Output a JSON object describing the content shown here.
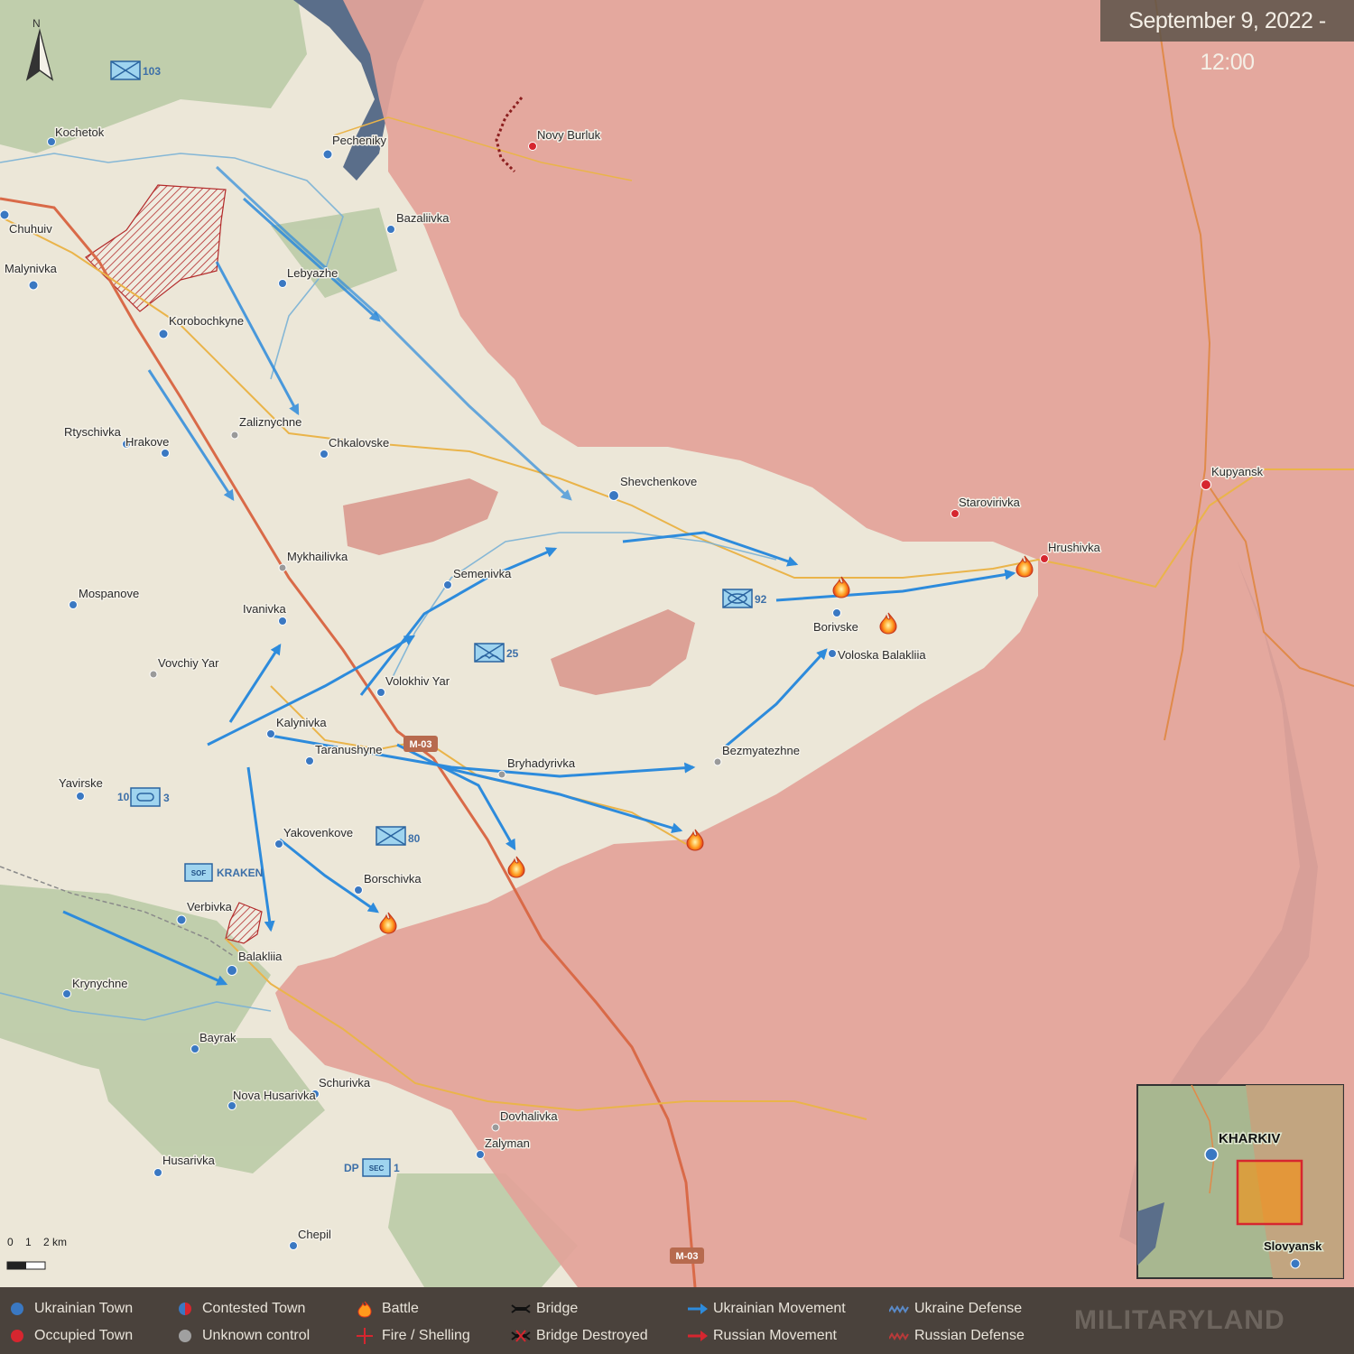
{
  "timestamp": "September 9, 2022 - 12:00",
  "north_label": "N",
  "colors": {
    "occupied": "#e3a399",
    "ukraine_controlled": "#ece7d8",
    "water": "#5a6e8a",
    "ukrainian_town": "#3a78c2",
    "occupied_town": "#d6262f",
    "ukrainian_movement": "#2d8bdc",
    "road_main": "#e07050",
    "road_secondary": "#f0c040"
  },
  "towns": {
    "ukrainian": [
      {
        "name": "Kochetok"
      },
      {
        "name": "Pecheniky"
      },
      {
        "name": "Chuhuiv"
      },
      {
        "name": "Bazaliivka"
      },
      {
        "name": "Malynivka"
      },
      {
        "name": "Lebyazhe"
      },
      {
        "name": "Korobochkyne"
      },
      {
        "name": "Rtyschivka"
      },
      {
        "name": "Hrakove"
      },
      {
        "name": "Chkalovske"
      },
      {
        "name": "Shevchenkove"
      },
      {
        "name": "Semenivka"
      },
      {
        "name": "Mospanove"
      },
      {
        "name": "Ivanivka"
      },
      {
        "name": "Volokhiv Yar"
      },
      {
        "name": "Borivske"
      },
      {
        "name": "Voloska Balakliia"
      },
      {
        "name": "Kalynivka"
      },
      {
        "name": "Taranushyne"
      },
      {
        "name": "Yavirske"
      },
      {
        "name": "Yakovenkove"
      },
      {
        "name": "Borschivka"
      },
      {
        "name": "Verbivka"
      },
      {
        "name": "Balakliia"
      },
      {
        "name": "Krynychne"
      },
      {
        "name": "Bayrak"
      },
      {
        "name": "Schurivka"
      },
      {
        "name": "Nova Husarivka"
      },
      {
        "name": "Zalyman"
      },
      {
        "name": "Husarivka"
      },
      {
        "name": "Chepil"
      }
    ],
    "occupied": [
      {
        "name": "Novy Burluk"
      },
      {
        "name": "Starovirivka"
      },
      {
        "name": "Hrushivka"
      },
      {
        "name": "Kupyansk"
      }
    ],
    "unknown": [
      {
        "name": "Zaliznychne"
      },
      {
        "name": "Mykhailivka"
      },
      {
        "name": "Vovchiy Yar"
      },
      {
        "name": "Bryhadyrivka"
      },
      {
        "name": "Bezmyatezhne"
      },
      {
        "name": "Dovhalivka"
      }
    ]
  },
  "units": [
    {
      "id": "103",
      "type": "infantry"
    },
    {
      "id": "92",
      "type": "mechanized"
    },
    {
      "id": "25",
      "type": "airborne"
    },
    {
      "id": "80",
      "type": "air-assault"
    },
    {
      "id": "10",
      "type": "armor",
      "suffix": "3"
    },
    {
      "id": "SOF",
      "name": "KRAKEN"
    },
    {
      "id": "SEC",
      "prefix": "DP",
      "suffix": "1"
    }
  ],
  "roads": [
    "M-03",
    "M-03"
  ],
  "scale_bar": {
    "labels": [
      "0",
      "1",
      "2 km"
    ]
  },
  "inset": {
    "city": "KHARKIV",
    "city2": "Slovyansk"
  },
  "legend": [
    {
      "label": "Ukrainian Town",
      "icon": "blue-dot"
    },
    {
      "label": "Occupied Town",
      "icon": "red-dot"
    },
    {
      "label": "Contested Town",
      "icon": "half-dot"
    },
    {
      "label": "Unknown control",
      "icon": "grey-dot"
    },
    {
      "label": "Battle",
      "icon": "fire"
    },
    {
      "label": "Fire / Shelling",
      "icon": "red-cross"
    },
    {
      "label": "Bridge",
      "icon": "bridge"
    },
    {
      "label": "Bridge Destroyed",
      "icon": "bridge-destroyed"
    },
    {
      "label": "Ukrainian Movement",
      "icon": "blue-arrow"
    },
    {
      "label": "Russian Movement",
      "icon": "red-arrow"
    },
    {
      "label": "Ukraine Defense",
      "icon": "blue-teeth"
    },
    {
      "label": "Russian Defense",
      "icon": "red-teeth"
    }
  ],
  "brand": "MILITARYLAND"
}
